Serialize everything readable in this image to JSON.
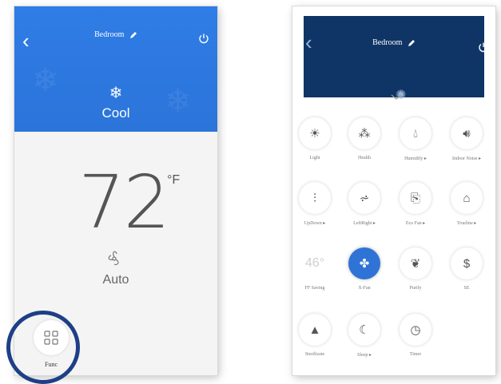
{
  "left_screen": {
    "title": "Bedroom",
    "mode_label": "Cool",
    "temperature": "72",
    "unit": "°F",
    "fan_label": "Auto",
    "function_label": "Func",
    "colors": {
      "header": "#2f7de6",
      "highlight_ring": "#1e3f86"
    }
  },
  "right_screen": {
    "title": "Bedroom",
    "colors": {
      "header": "#0f3566",
      "active": "#2f73d6"
    },
    "grid": [
      {
        "label": "Light",
        "icon": "sun-icon"
      },
      {
        "label": "Health",
        "icon": "tree-icon"
      },
      {
        "label": "Humidify ▸",
        "icon": "droplet-icon"
      },
      {
        "label": "Indoor Noise ▸",
        "icon": "speaker-icon"
      },
      {
        "label": "UpDown ▸",
        "icon": "vertical-swing-icon"
      },
      {
        "label": "LeftRight ▸",
        "icon": "horizontal-swing-icon"
      },
      {
        "label": "Eco Fan ▸",
        "icon": "eco-fan-icon"
      },
      {
        "label": "Trueline ▸",
        "icon": "house-icon"
      },
      {
        "label": "FF Saving",
        "icon": "temp-46-text",
        "text": "46°"
      },
      {
        "label": "X-Fan",
        "icon": "fan-icon"
      },
      {
        "label": "Purify",
        "icon": "leaf-icon"
      },
      {
        "label": "SE",
        "icon": "dollar-icon",
        "text": "$"
      },
      {
        "label": "Sterilizate",
        "icon": "triangle-icon"
      },
      {
        "label": "Sleep ▸",
        "icon": "moon-icon"
      },
      {
        "label": "Timer",
        "icon": "clock-icon"
      }
    ]
  }
}
